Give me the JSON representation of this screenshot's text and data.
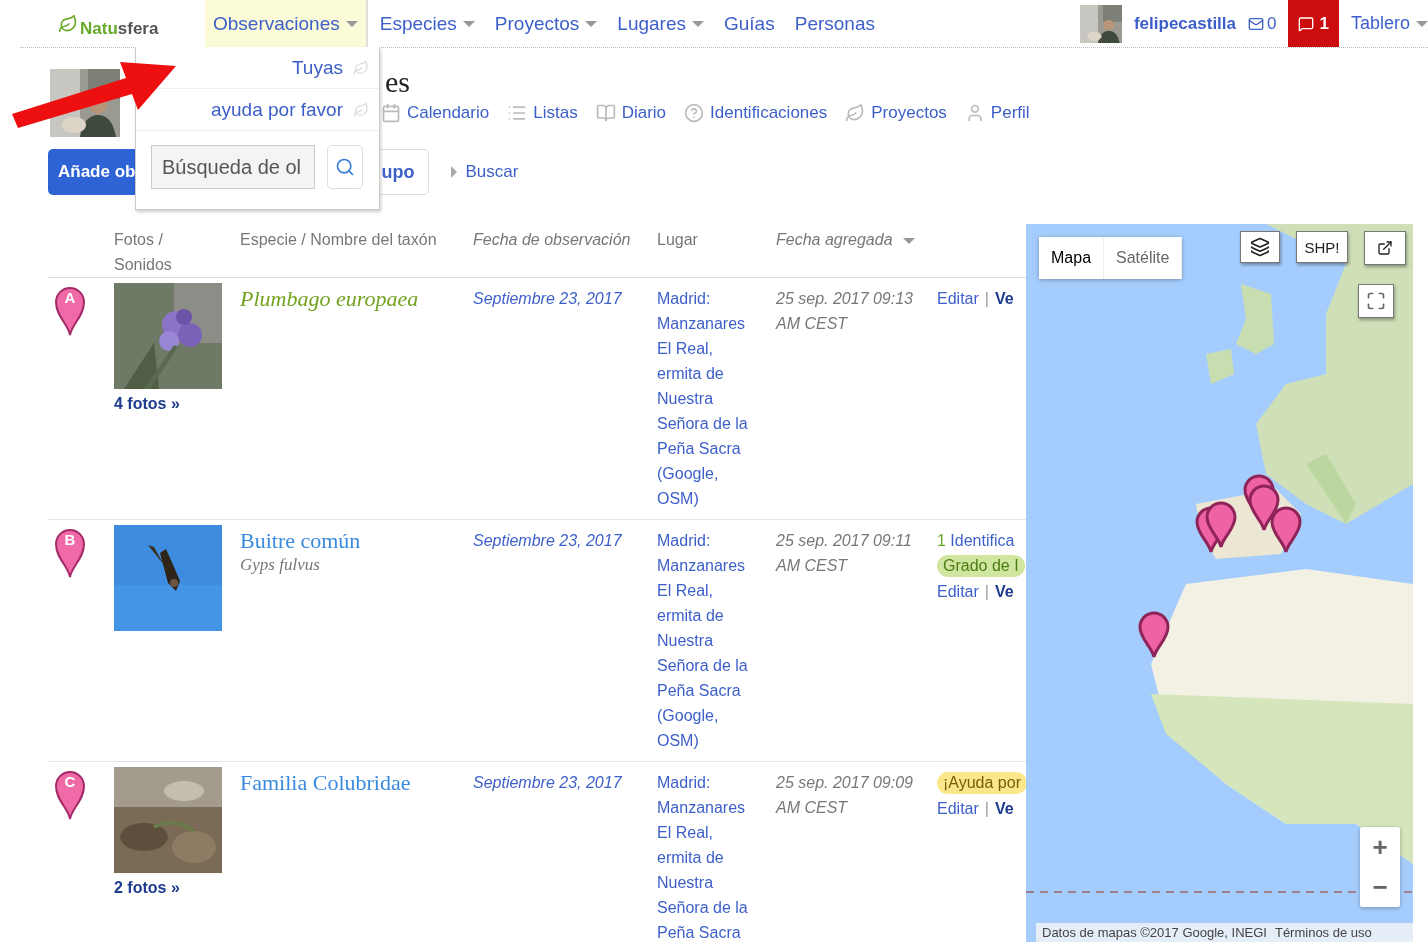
{
  "logo": {
    "text_a": "Natu",
    "text_b": "sfera"
  },
  "nav": [
    {
      "label": "Observaciones",
      "has_menu": true,
      "selected": true
    },
    {
      "label": "Especies",
      "has_menu": true,
      "selected": false
    },
    {
      "label": "Proyectos",
      "has_menu": true,
      "selected": false
    },
    {
      "label": "Lugares",
      "has_menu": true,
      "selected": false
    },
    {
      "label": "Guías",
      "has_menu": false,
      "selected": false
    },
    {
      "label": "Personas",
      "has_menu": false,
      "selected": false
    }
  ],
  "user": {
    "name": "felipecastilla",
    "mail_count": "0",
    "alerts_count": "1",
    "dashboard": "Tablero"
  },
  "dropdown": {
    "items": [
      "Tuyas",
      "ayuda por favor"
    ],
    "search": {
      "placeholder": "Búsqueda de ol"
    }
  },
  "profile": {
    "title": "es",
    "subnav": [
      {
        "kind": "calendar",
        "label": "Calendario"
      },
      {
        "kind": "list",
        "label": "Listas"
      },
      {
        "kind": "journal",
        "label": "Diario"
      },
      {
        "kind": "identifications",
        "label": "Identificaciones"
      },
      {
        "kind": "projects",
        "label": "Proyectos"
      },
      {
        "kind": "profile",
        "label": "Perfil"
      }
    ],
    "add_button": "Añade ob",
    "group_button": "upo",
    "search_link": "Buscar"
  },
  "table": {
    "columns": [
      "Fotos / Sonidos",
      "Especie / Nombre del taxón",
      "Fecha de observación",
      "Lugar",
      "Fecha agregada"
    ],
    "rows": [
      {
        "marker": "A",
        "photo_count": "4 fotos »",
        "name": "Plumbago europaea",
        "kind": "scientific",
        "date": "Septiembre 23, 2017",
        "place": "Madrid: Manzanares El Real, ermita de Nuestra Señora de la Peña Sacra",
        "place_links": "(Google, OSM)",
        "added": "25 sep. 2017 09:13 AM CEST",
        "actions": {
          "edit": "Editar",
          "separator": "|",
          "view": "Ve"
        }
      },
      {
        "marker": "B",
        "name": "Buitre común",
        "scientific_name": "Gyps fulvus",
        "kind": "common",
        "date": "Septiembre 23, 2017",
        "place": "Madrid: Manzanares El Real, ermita de Nuestra Señora de la Peña Sacra",
        "place_links": "(Google, OSM)",
        "added": "25 sep. 2017 09:11 AM CEST",
        "identifications": {
          "count": "1",
          "label": "Identifica"
        },
        "badge": {
          "label": "Grado de I",
          "kind": "research"
        },
        "actions": {
          "edit": "Editar",
          "separator": "|",
          "view": "Ve"
        }
      },
      {
        "marker": "C",
        "photo_count": "2 fotos »",
        "name": "Familia Colubridae",
        "kind": "common",
        "date": "Septiembre 23, 2017",
        "place": "Madrid: Manzanares El Real, ermita de Nuestra Señora de la Peña Sacra",
        "added": "25 sep. 2017 09:09 AM CEST",
        "badge": {
          "label": "¡Ayuda por",
          "kind": "needs_id"
        },
        "actions": {
          "edit": "Editar",
          "separator": "|",
          "view": "Ve"
        }
      }
    ]
  },
  "map": {
    "map_types": [
      {
        "label": "Mapa",
        "selected": true
      },
      {
        "label": "Satélite",
        "selected": false
      }
    ],
    "shp_button": "SHP!",
    "zoom_in": "+",
    "zoom_out": "−",
    "attribution": "Datos de mapas ©2017 Google, INEGI",
    "terms": "Términos de uso"
  }
}
